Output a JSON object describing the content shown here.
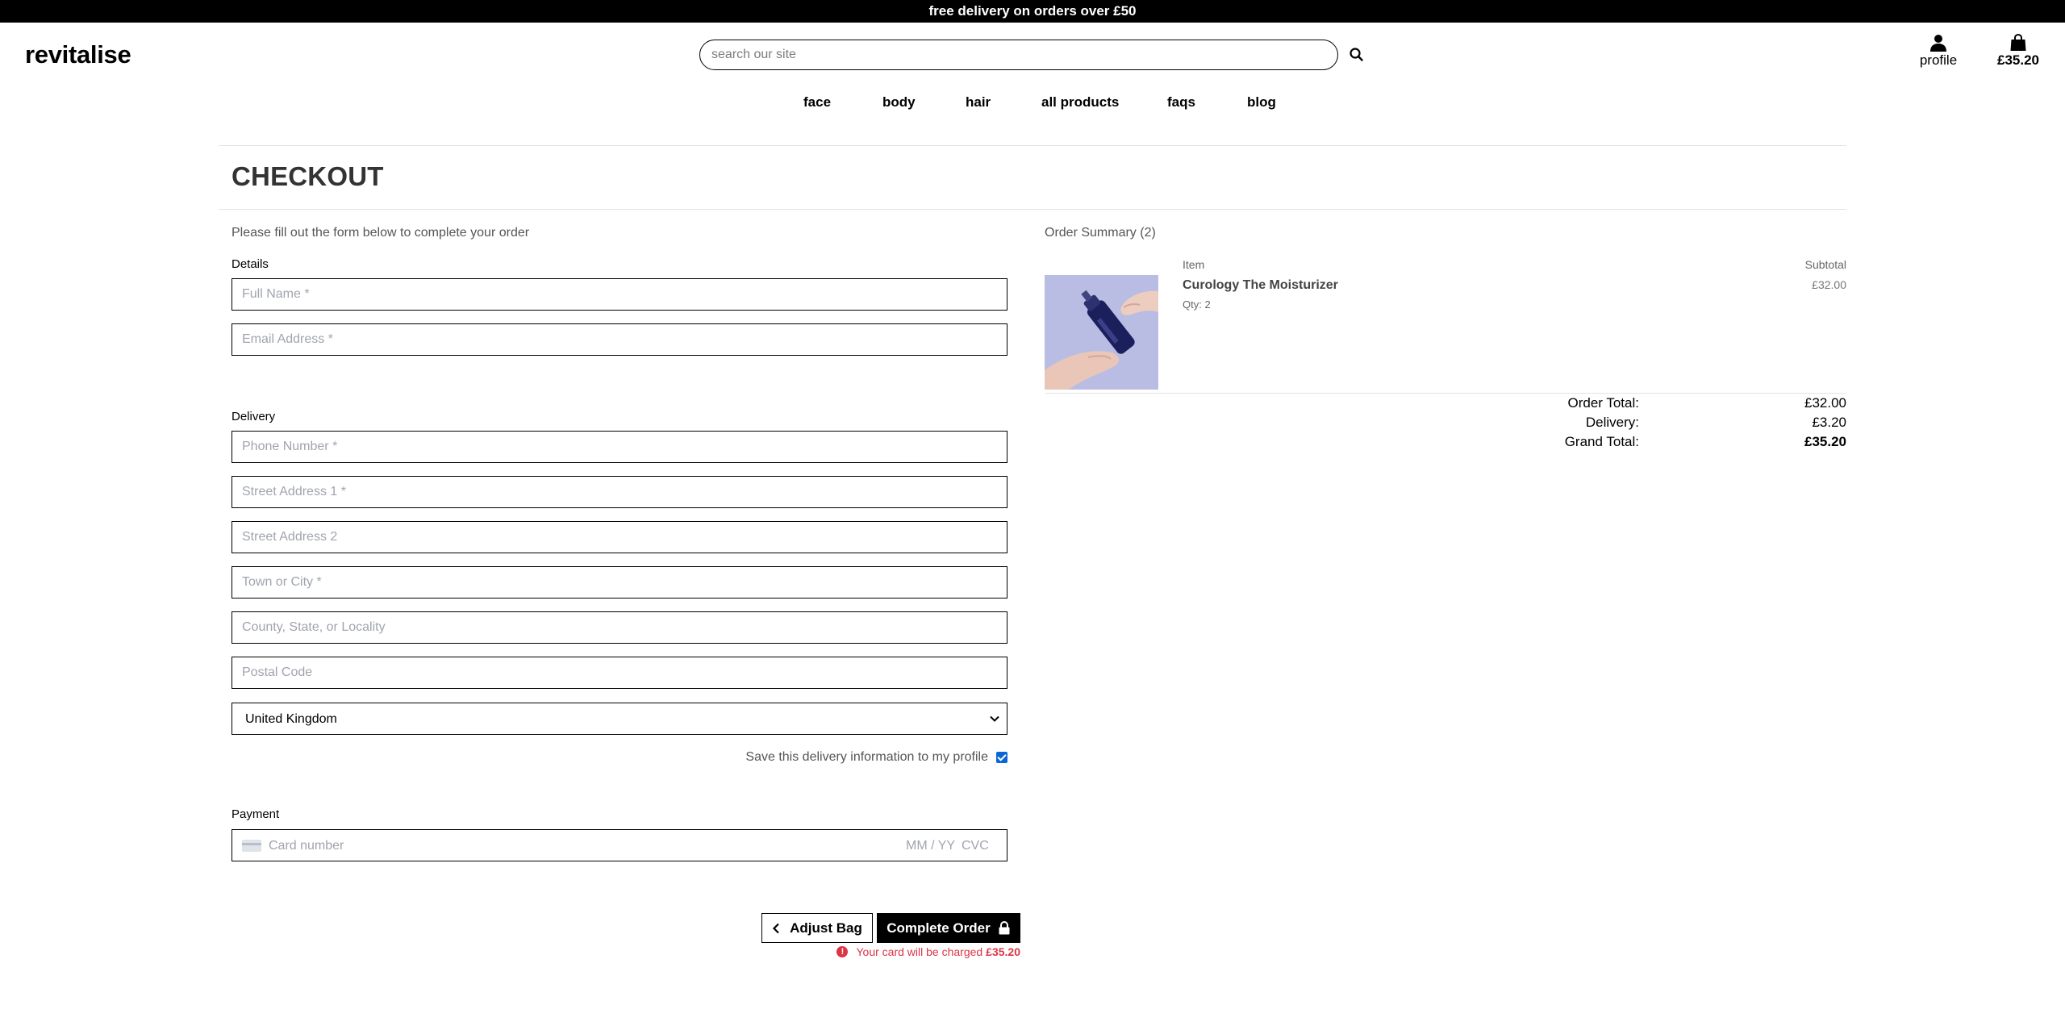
{
  "announcement": "free delivery on orders over £50",
  "header": {
    "logo": "revitalise",
    "search_placeholder": "search our site",
    "profile_label": "profile",
    "bag_total": "£35.20"
  },
  "nav": [
    "face",
    "body",
    "hair",
    "all products",
    "faqs",
    "blog"
  ],
  "page_title": "CHECKOUT",
  "form": {
    "intro": "Please fill out the form below to complete your order",
    "details_label": "Details",
    "full_name_placeholder": "Full Name *",
    "email_placeholder": "Email Address *",
    "delivery_label": "Delivery",
    "phone_placeholder": "Phone Number *",
    "street1_placeholder": "Street Address 1 *",
    "street2_placeholder": "Street Address 2",
    "town_placeholder": "Town or City *",
    "county_placeholder": "County, State, or Locality",
    "postcode_placeholder": "Postal Code",
    "country_selected": "United Kingdom",
    "save_info_label": "Save this delivery information to my profile",
    "save_info_checked": true,
    "payment_label": "Payment",
    "card_number_placeholder": "Card number",
    "card_expiry_placeholder": "MM / YY",
    "card_cvc_placeholder": "CVC"
  },
  "actions": {
    "adjust_bag": "Adjust Bag",
    "complete_order": "Complete Order",
    "charge_note": "Your card will be charged",
    "charge_amount": "£35.20"
  },
  "summary": {
    "title": "Order Summary (2)",
    "col_item": "Item",
    "col_subtotal": "Subtotal",
    "items": [
      {
        "name": "Curology The Moisturizer",
        "qty": "Qty: 2",
        "subtotal": "£32.00"
      }
    ],
    "order_total_label": "Order Total:",
    "order_total": "£32.00",
    "delivery_label": "Delivery:",
    "delivery": "£3.20",
    "grand_total_label": "Grand Total:",
    "grand_total": "£35.20"
  },
  "colors": {
    "topbar": "#000000",
    "error": "#dc3545",
    "checkbox": "#0a66d6"
  }
}
